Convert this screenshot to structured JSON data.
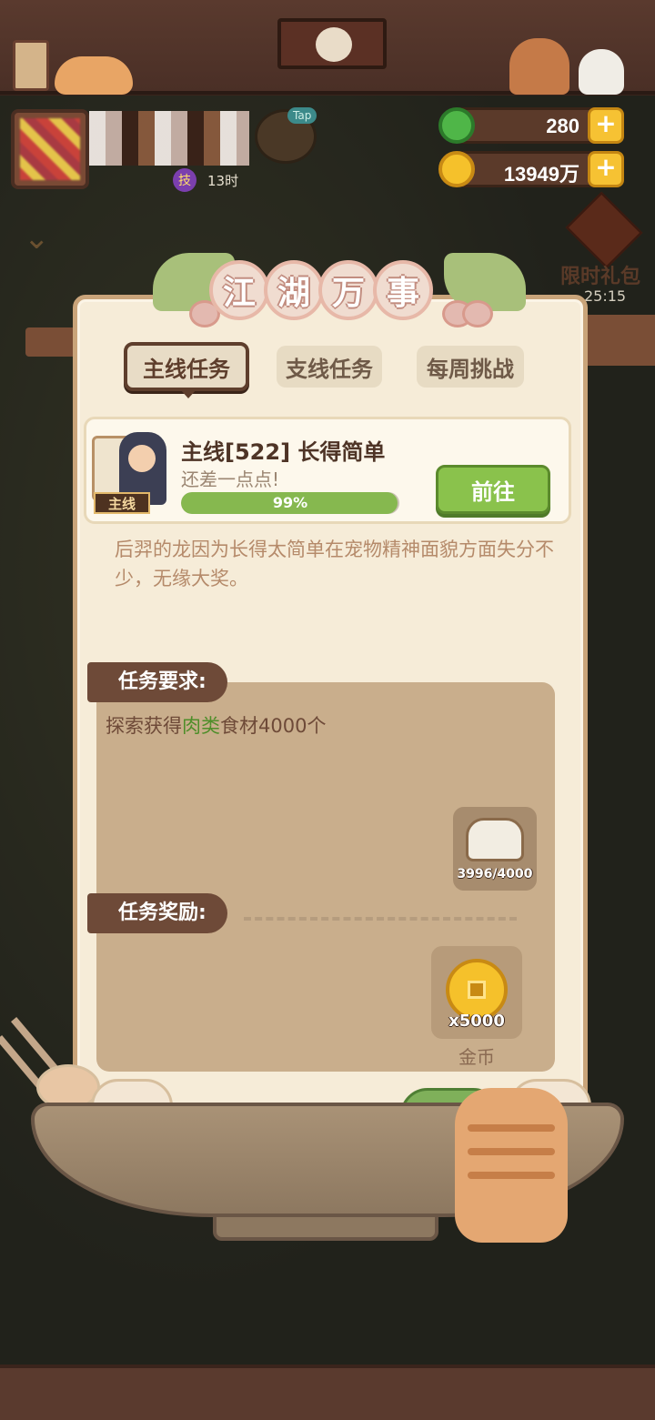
{
  "currency": {
    "jade": "280",
    "gold": "13949万"
  },
  "player": {
    "level_badge": "技",
    "timer": "13时",
    "tap_label": "Tap"
  },
  "limited_gift": {
    "label": "限时礼包",
    "countdown": "25:15"
  },
  "title": {
    "chars": [
      "江",
      "湖",
      "万",
      "事"
    ]
  },
  "tabs": [
    {
      "label": "主线任务",
      "active": true
    },
    {
      "label": "支线任务",
      "active": false
    },
    {
      "label": "每周挑战",
      "active": false
    }
  ],
  "quest": {
    "tag": "主线",
    "title": "主线[522] 长得简单",
    "subtitle": "还差一点点!",
    "progress": 0.99,
    "progress_label": "99%",
    "go_label": "前往",
    "description": "后羿的龙因为长得太简单在宠物精神面貌方面失分不少，无缘大奖。"
  },
  "requirements": {
    "header": "任务要求:",
    "text_before": "探索获得",
    "highlight": "肉类",
    "text_after": "食材4000个",
    "item_count": "3996/4000"
  },
  "rewards": {
    "header": "任务奖励:",
    "items": [
      {
        "amount": "x5000",
        "name": "金币"
      }
    ]
  },
  "colors": {
    "accent_green": "#8ac24c",
    "panel_bg": "#f6ecd8",
    "highlight_green": "#4f8e2a"
  }
}
